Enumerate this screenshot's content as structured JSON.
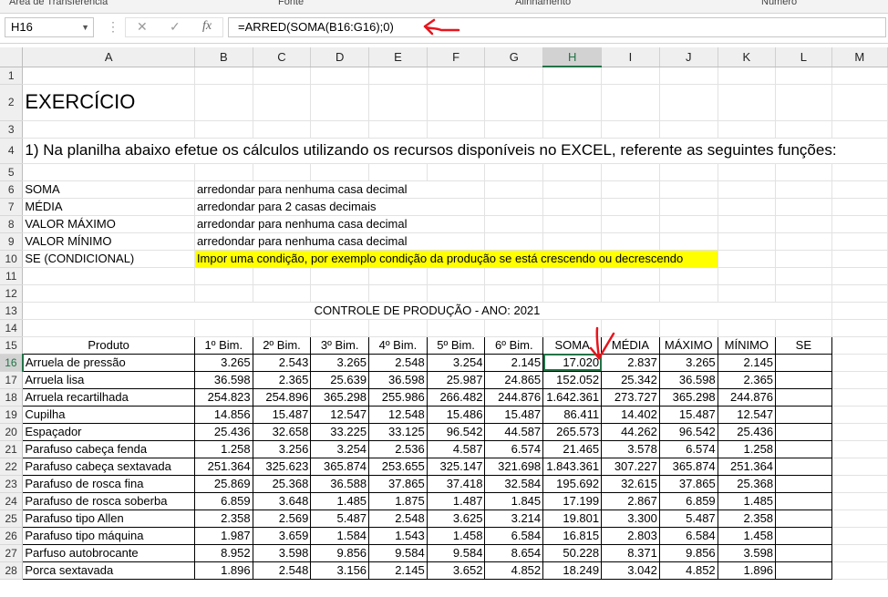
{
  "ribbon": {
    "groups": [
      "Área de Transferência",
      "Fonte",
      "Alinhamento",
      "Número"
    ]
  },
  "formula_bar": {
    "name_box": "H16",
    "formula": "=ARRED(SOMA(B16:G16);0)",
    "cancel_glyph": "✕",
    "enter_glyph": "✓",
    "fx_label": "fx"
  },
  "columns": [
    "A",
    "B",
    "C",
    "D",
    "E",
    "F",
    "G",
    "H",
    "I",
    "J",
    "K",
    "L",
    "M"
  ],
  "sheet": {
    "title": "EXERCÍCIO",
    "instruction": "1) Na planilha abaixo efetue os cálculos utilizando os recursos disponíveis no EXCEL, referente as seguintes funções:",
    "functions": [
      {
        "name": "SOMA",
        "desc": "arredondar para nenhuma casa decimal"
      },
      {
        "name": "MÉDIA",
        "desc": "arredondar para 2 casas decimais"
      },
      {
        "name": "VALOR MÁXIMO",
        "desc": "arredondar para nenhuma casa decimal"
      },
      {
        "name": "VALOR MÍNIMO",
        "desc": "arredondar para nenhuma casa decimal"
      },
      {
        "name": "SE (CONDICIONAL)",
        "desc": "Impor uma condição, por exemplo condição da produção se está crescendo ou decrescendo"
      }
    ],
    "table_title": "CONTROLE DE PRODUÇÃO - ANO: 2021",
    "headers": [
      "Produto",
      "1º Bim.",
      "2º Bim.",
      "3º Bim.",
      "4º Bim.",
      "5º Bim.",
      "6º Bim.",
      "SOMA",
      "MÉDIA",
      "MÁXIMO",
      "MÍNIMO",
      "SE"
    ],
    "rows": [
      [
        "Arruela de pressão",
        "3.265",
        "2.543",
        "3.265",
        "2.548",
        "3.254",
        "2.145",
        "17.020",
        "2.837",
        "3.265",
        "2.145",
        ""
      ],
      [
        "Arruela lisa",
        "36.598",
        "2.365",
        "25.639",
        "36.598",
        "25.987",
        "24.865",
        "152.052",
        "25.342",
        "36.598",
        "2.365",
        ""
      ],
      [
        "Arruela recartilhada",
        "254.823",
        "254.896",
        "365.298",
        "255.986",
        "266.482",
        "244.876",
        "1.642.361",
        "273.727",
        "365.298",
        "244.876",
        ""
      ],
      [
        "Cupilha",
        "14.856",
        "15.487",
        "12.547",
        "12.548",
        "15.486",
        "15.487",
        "86.411",
        "14.402",
        "15.487",
        "12.547",
        ""
      ],
      [
        "Espaçador",
        "25.436",
        "32.658",
        "33.225",
        "33.125",
        "96.542",
        "44.587",
        "265.573",
        "44.262",
        "96.542",
        "25.436",
        ""
      ],
      [
        "Parafuso cabeça fenda",
        "1.258",
        "3.256",
        "3.254",
        "2.536",
        "4.587",
        "6.574",
        "21.465",
        "3.578",
        "6.574",
        "1.258",
        ""
      ],
      [
        "Parafuso cabeça sextavada",
        "251.364",
        "325.623",
        "365.874",
        "253.655",
        "325.147",
        "321.698",
        "1.843.361",
        "307.227",
        "365.874",
        "251.364",
        ""
      ],
      [
        "Parafuso de rosca fina",
        "25.869",
        "25.368",
        "36.588",
        "37.865",
        "37.418",
        "32.584",
        "195.692",
        "32.615",
        "37.865",
        "25.368",
        ""
      ],
      [
        "Parafuso de rosca soberba",
        "6.859",
        "3.648",
        "1.485",
        "1.875",
        "1.487",
        "1.845",
        "17.199",
        "2.867",
        "6.859",
        "1.485",
        ""
      ],
      [
        "Parafuso tipo Allen",
        "2.358",
        "2.569",
        "5.487",
        "2.548",
        "3.625",
        "3.214",
        "19.801",
        "3.300",
        "5.487",
        "2.358",
        ""
      ],
      [
        "Parafuso tipo máquina",
        "1.987",
        "3.659",
        "1.584",
        "1.543",
        "1.458",
        "6.584",
        "16.815",
        "2.803",
        "6.584",
        "1.458",
        ""
      ],
      [
        "Parfuso autobrocante",
        "8.952",
        "3.598",
        "9.856",
        "9.584",
        "9.584",
        "8.654",
        "50.228",
        "8.371",
        "9.856",
        "3.598",
        ""
      ],
      [
        "Porca sextavada",
        "1.896",
        "2.548",
        "3.156",
        "2.145",
        "3.652",
        "4.852",
        "18.249",
        "3.042",
        "4.852",
        "1.896",
        ""
      ]
    ]
  },
  "annotation_color": "#e8141c"
}
